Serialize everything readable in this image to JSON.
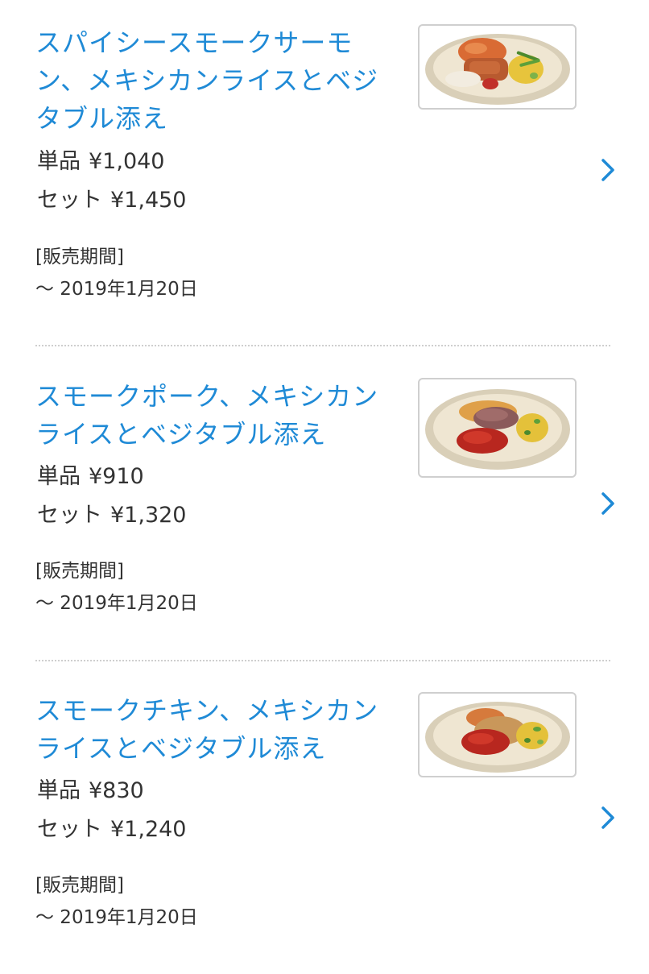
{
  "items": [
    {
      "title": "スパイシースモークサーモン、メキシカンライスとベジタブル添え",
      "single_label": "単品",
      "single_price": "¥1,040",
      "set_label": "セット",
      "set_price": "¥1,450",
      "period_label": "[販売期間]",
      "period_value": "～ 2019年1月20日",
      "image_icon": "salmon-plate-photo",
      "chevron_icon": "chevron-right-icon"
    },
    {
      "title": "スモークポーク、メキシカンライスとベジタブル添え",
      "single_label": "単品",
      "single_price": "¥910",
      "set_label": "セット",
      "set_price": "¥1,320",
      "period_label": "[販売期間]",
      "period_value": "～ 2019年1月20日",
      "image_icon": "pork-plate-photo",
      "chevron_icon": "chevron-right-icon"
    },
    {
      "title": "スモークチキン、メキシカンライスとベジタブル添え",
      "single_label": "単品",
      "single_price": "¥830",
      "set_label": "セット",
      "set_price": "¥1,240",
      "period_label": "[販売期間]",
      "period_value": "～ 2019年1月20日",
      "image_icon": "chicken-plate-photo",
      "chevron_icon": "chevron-right-icon"
    }
  ],
  "colors": {
    "title": "#1f8ad6",
    "text": "#333333",
    "chevron": "#1f8ad6",
    "divider": "#cfcfcf",
    "thumb_border": "#cfcfcf"
  }
}
